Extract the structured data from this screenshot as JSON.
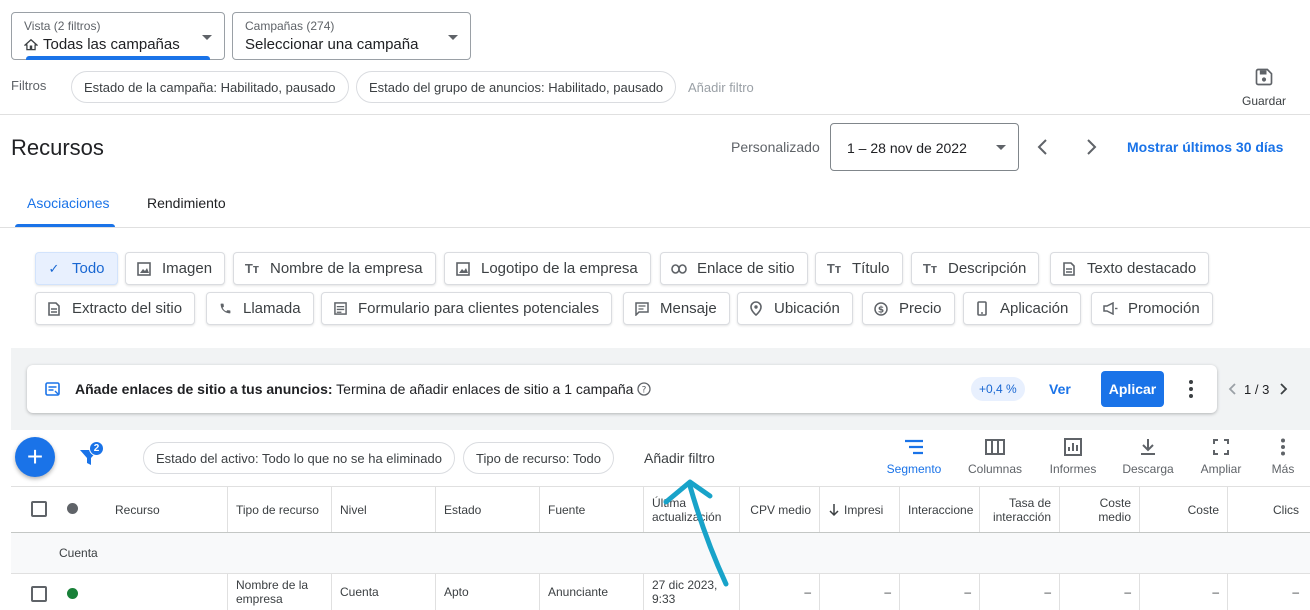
{
  "view_selector": {
    "label": "Vista (2 filtros)",
    "value": "Todas las campañas"
  },
  "campaign_selector": {
    "label": "Campañas (274)",
    "value": "Seleccionar una campaña"
  },
  "filters": {
    "label": "Filtros",
    "chips": [
      "Estado de la campaña: Habilitado, pausado",
      "Estado del grupo de anuncios: Habilitado, pausado"
    ],
    "add": "Añadir filtro"
  },
  "save_label": "Guardar",
  "page_title": "Recursos",
  "date": {
    "mode": "Personalizado",
    "range": "1 – 28 nov de 2022",
    "last30": "Mostrar últimos 30 días"
  },
  "tabs": [
    "Asociaciones",
    "Rendimiento"
  ],
  "asset_types": {
    "row1": [
      "Todo",
      "Imagen",
      "Nombre de la empresa",
      "Logotipo de la empresa",
      "Enlace de sitio",
      "Título",
      "Descripción",
      "Texto destacado"
    ],
    "row2": [
      "Extracto del sitio",
      "Llamada",
      "Formulario para clientes potenciales",
      "Mensaje",
      "Ubicación",
      "Precio",
      "Aplicación",
      "Promoción"
    ]
  },
  "recommendation": {
    "title": "Añade enlaces de sitio a tus anuncios:",
    "text": "Termina de añadir enlaces de sitio a 1 campaña",
    "badge": "+0,4 %",
    "view": "Ver",
    "apply": "Aplicar",
    "pager": "1 / 3"
  },
  "toolbar": {
    "filter_count": "2",
    "chips": [
      "Estado del activo: Todo lo que no se ha eliminado",
      "Tipo de recurso: Todo"
    ],
    "add_filter": "Añadir filtro",
    "tools": [
      "Segmento",
      "Columnas",
      "Informes",
      "Descarga",
      "Ampliar",
      "Más"
    ]
  },
  "table": {
    "headers": [
      "Recurso",
      "Tipo de recurso",
      "Nivel",
      "Estado",
      "Fuente",
      "Última actualización",
      "CPV medio",
      "Impresi",
      "Interaccione",
      "Tasa de interacción",
      "Coste medio",
      "Coste",
      "Clics"
    ],
    "group_label": "Cuenta",
    "row": [
      "",
      "Nombre de la empresa",
      "Cuenta",
      "Apto",
      "Anunciante",
      "27 dic 2023, 9:33",
      "–",
      "–",
      "–",
      "–",
      "–",
      "–",
      "–"
    ]
  },
  "colors": {
    "accent": "#1a73e8",
    "status_green": "#188038"
  },
  "annotation": "arrow pointing to Añadir filtro"
}
